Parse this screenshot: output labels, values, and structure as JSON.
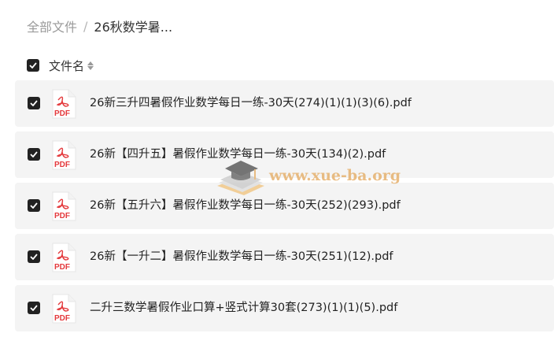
{
  "breadcrumb": {
    "root": "全部文件",
    "separator": "/",
    "current": "26秋数学暑..."
  },
  "header": {
    "column_label": "文件名",
    "select_all_checked": true
  },
  "files": [
    {
      "name": "26新三升四暑假作业数学每日一练-30天(274)(1)(1)(3)(6).pdf",
      "type_label": "PDF",
      "checked": true
    },
    {
      "name": "26新【四升五】暑假作业数学每日一练-30天(134)(2).pdf",
      "type_label": "PDF",
      "checked": true
    },
    {
      "name": "26新【五升六】暑假作业数学每日一练-30天(252)(293).pdf",
      "type_label": "PDF",
      "checked": true
    },
    {
      "name": "26新【一升二】暑假作业数学每日一练-30天(251)(12).pdf",
      "type_label": "PDF",
      "checked": true
    },
    {
      "name": "二升三数学暑假作业口算+竖式计算30套(273)(1)(1)(5).pdf",
      "type_label": "PDF",
      "checked": true
    }
  ],
  "watermark": {
    "text": "www.xue-ba.org",
    "icon": "graduation-cap-book-icon"
  },
  "colors": {
    "row_bg": "#f4f4f4",
    "checkbox": "#222222",
    "pdf_red": "#e4393c",
    "watermark": "#e3a85c"
  }
}
